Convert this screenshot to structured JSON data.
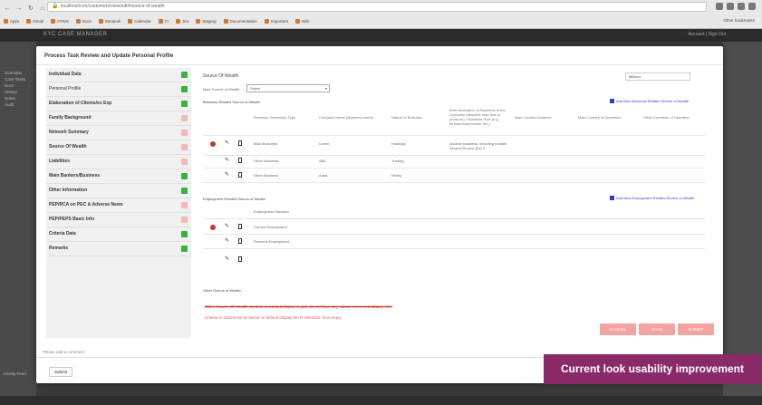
{
  "browser": {
    "url": "localhost/crm/customers/view/edit#source-of-wealth",
    "bookmarks": [
      "Apps",
      "Gmail",
      "ATWS",
      "Docs",
      "Zendesk",
      "Calendar",
      "CI",
      "Jira",
      "Staging",
      "Documentation",
      "Important",
      "Wiki"
    ],
    "bookmarks_right": "Other bookmarks"
  },
  "app": {
    "title": "KYC CASE MANAGER",
    "user": "Account | Sign Out",
    "sidebar_items": [
      "Overview",
      "Case Tasks",
      "Docs",
      "History",
      "Notes",
      "Audit"
    ],
    "bottom_note": "Activity Feed"
  },
  "modal": {
    "title": "Process Task Review and Update Personal Profile",
    "nav_items": [
      {
        "label": "Individual Data",
        "status": "green",
        "sub": false
      },
      {
        "label": "Personal Profile",
        "status": "green",
        "sub": true
      },
      {
        "label": "Elaboration of Clients/ex Exp",
        "status": "green",
        "sub": false
      },
      {
        "label": "Family Background",
        "status": "pink",
        "sub": false
      },
      {
        "label": "Network Summary",
        "status": "pink",
        "sub": false
      },
      {
        "label": "Source Of Wealth",
        "status": "pink",
        "sub": false
      },
      {
        "label": "Liabilities",
        "status": "pink",
        "sub": false
      },
      {
        "label": "Main Bankers/Business",
        "status": "green",
        "sub": false
      },
      {
        "label": "Other Information",
        "status": "green",
        "sub": false
      },
      {
        "label": "PEP/RCA on PEC & Adverse News",
        "status": "pink",
        "sub": false
      },
      {
        "label": "PEP/PEPS Basic Info",
        "status": "pink",
        "sub": false
      },
      {
        "label": "Criteria Data",
        "status": "green",
        "sub": false
      },
      {
        "label": "Remarks",
        "status": "green",
        "sub": false
      }
    ],
    "content": {
      "section_title": "Source Of Wealth",
      "right_select": "Millions",
      "source_label": "Main Source of Wealth",
      "source_value": "Select",
      "business_title": "Business Related Source of Wealth",
      "business_add": "Add New Business Related Source of Wealth",
      "business_headers": [
        "Business Ownership Type",
        "Company Name (Business name)",
        "Nature of Business",
        "Brief description of Business of the Company (describe main line of products) / Business Role (e.g. founder/shareholder etc.)",
        "Main Location Address",
        "Main Country of Operation",
        "Other Countries of Operation"
      ],
      "business_rows": [
        [
          "Main Business",
          "Lorem",
          "Holdings",
          "Another business, including notable Second Source (Ex) 2"
        ],
        [
          "Other Business",
          "ABC",
          "Trading",
          ""
        ],
        [
          "Other Business",
          "Aaaa",
          "Realty",
          ""
        ]
      ],
      "employment_title": "Employment Related Source of Wealth",
      "employment_add": "Add New Employment Related Source of Wealth",
      "employment_rows": [
        "Employment Situation",
        "Current Employment",
        "Previous Employment"
      ],
      "other_title": "Other Source of Wealth",
      "warning_strike": "Other Source Of Wealth Section is marked display a grid, do not have any values set as mandatory rule.",
      "warning_text": "Criteria to submit set as below, to default display the R selection, first empty.",
      "buttons": [
        "CANCEL",
        "SAVE",
        "SUBMIT"
      ]
    },
    "foot_note": "Please add a comment",
    "foot_button": "Submit"
  },
  "banner": {
    "text": "Current look usability improvement"
  },
  "colors": {
    "green": "#3cb043",
    "pink": "#f4b8b8",
    "link": "#2b3ed1",
    "banner": "#8b2a68",
    "button": "#f4a3a3"
  }
}
